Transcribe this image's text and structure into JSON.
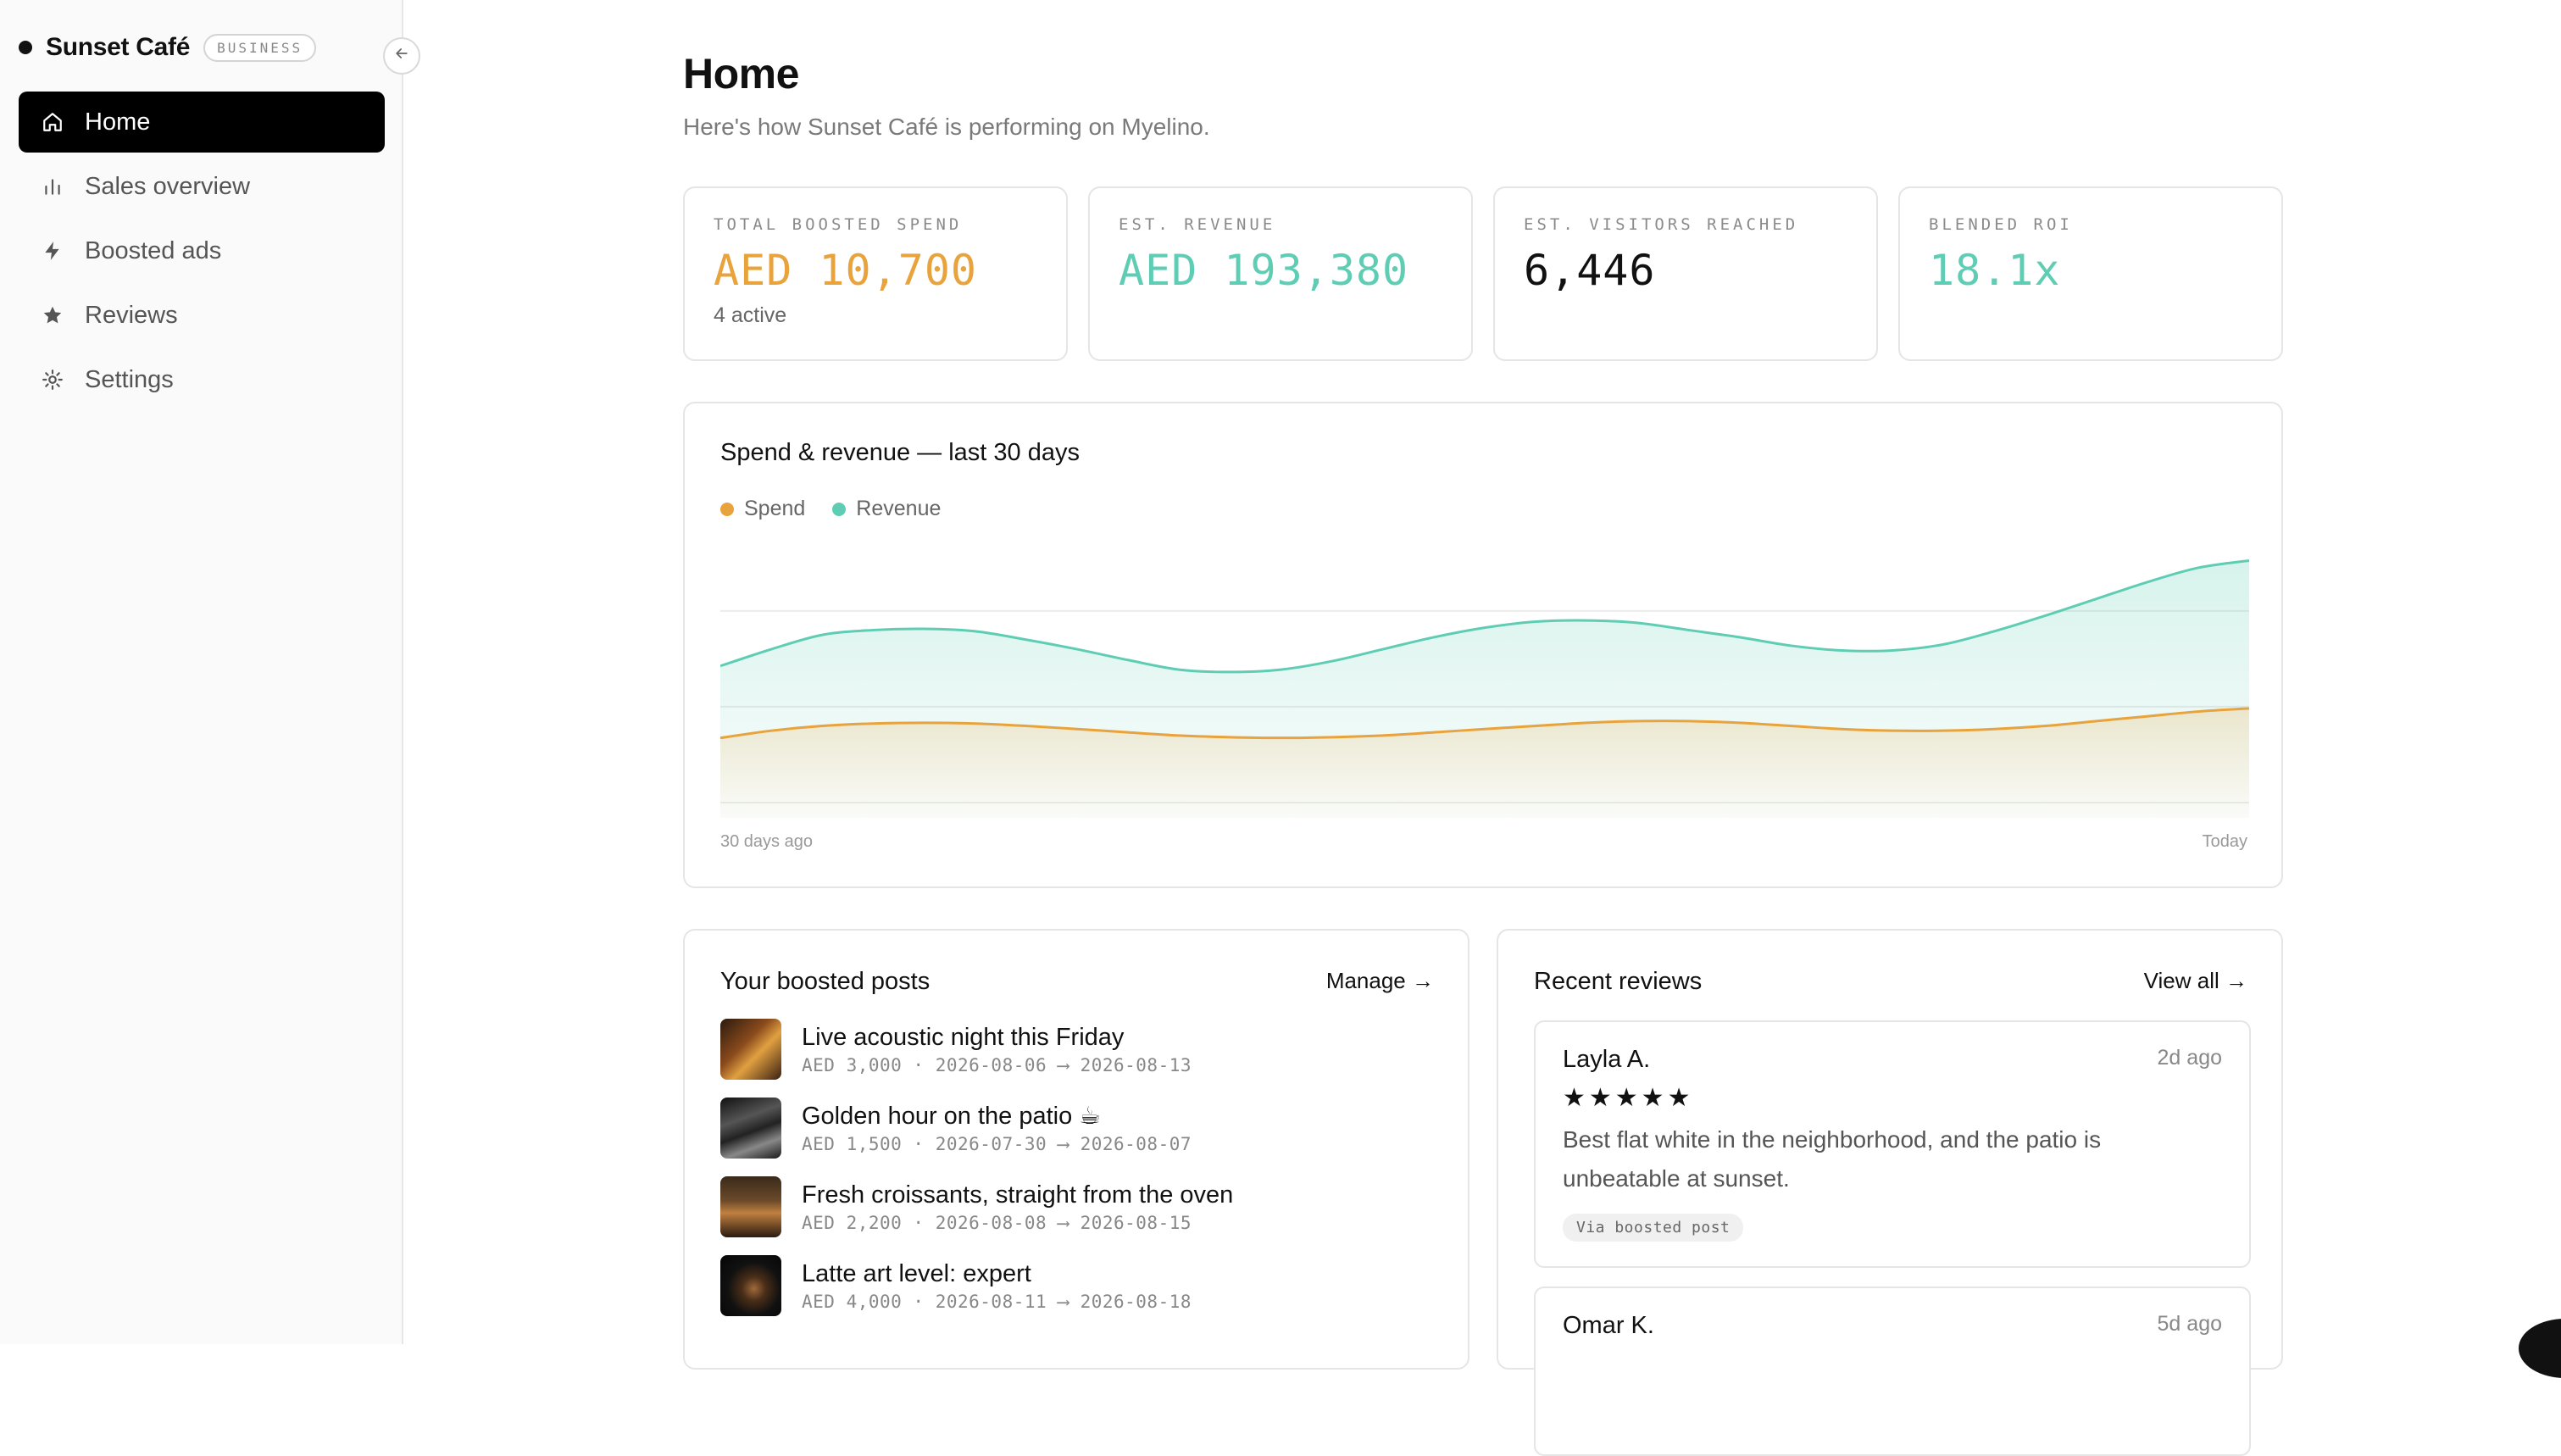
{
  "brand": {
    "name": "Sunset Café",
    "badge": "BUSINESS"
  },
  "sidebar": {
    "collapse_icon": "arrow-left-icon",
    "items": [
      {
        "label": "Home",
        "icon": "home-icon",
        "active": true
      },
      {
        "label": "Sales overview",
        "icon": "bar-chart-icon",
        "active": false
      },
      {
        "label": "Boosted ads",
        "icon": "lightning-icon",
        "active": false
      },
      {
        "label": "Reviews",
        "icon": "star-icon",
        "active": false
      },
      {
        "label": "Settings",
        "icon": "gear-icon",
        "active": false
      }
    ]
  },
  "header": {
    "title": "Home",
    "subtitle": "Here's how Sunset Café is performing on Myelino."
  },
  "stats": [
    {
      "label": "TOTAL BOOSTED SPEND",
      "value": "AED 10,700",
      "sub": "4 active",
      "color": "#E8A33D"
    },
    {
      "label": "EST. REVENUE",
      "value": "AED 193,380",
      "sub": "",
      "color": "#5FCDB4"
    },
    {
      "label": "EST. VISITORS REACHED",
      "value": "6,446",
      "sub": "",
      "color": "#111111"
    },
    {
      "label": "BLENDED ROI",
      "value": "18.1x",
      "sub": "",
      "color": "#5FCDB4"
    }
  ],
  "chart": {
    "title": "Spend & revenue — last 30 days",
    "x_start_label": "30 days ago",
    "x_end_label": "Today"
  },
  "chart_data": {
    "type": "area",
    "title": "Spend & revenue — last 30 days",
    "x": [
      0,
      1,
      2,
      3,
      4,
      5,
      6,
      7,
      8,
      9,
      10,
      11,
      12,
      13,
      14,
      15,
      16,
      17,
      18,
      19,
      20,
      21,
      22,
      23,
      24,
      25,
      26,
      27,
      28,
      29,
      30
    ],
    "xlabel": "",
    "ylabel": "",
    "grid": true,
    "legend_position": "top-left",
    "series": [
      {
        "name": "Spend",
        "color": "#E8A33D",
        "values": [
          27,
          30,
          32,
          33,
          33.3,
          33,
          32,
          30.7,
          29.3,
          28,
          27.3,
          27,
          27.3,
          28,
          29.3,
          30.7,
          32,
          33.3,
          34,
          34,
          33.3,
          32,
          30.7,
          30,
          30,
          30.7,
          32,
          34,
          36,
          38,
          39.3
        ]
      },
      {
        "name": "Revenue",
        "color": "#5FCDB4",
        "values": [
          57,
          64,
          70,
          72,
          72.5,
          71.5,
          68,
          64,
          59.5,
          55.5,
          54.5,
          55.5,
          59,
          64,
          69,
          73,
          75.5,
          76,
          75,
          72,
          69,
          65.5,
          63.5,
          63.5,
          66,
          71.5,
          78,
          85,
          92,
          98,
          101
        ]
      }
    ],
    "ylim": [
      0,
      110
    ]
  },
  "posts_card": {
    "title": "Your boosted posts",
    "link": "Manage →",
    "posts": [
      {
        "title": "Live acoustic night this Friday",
        "meta": "AED 3,000 · 2026-08-06 ⟶ 2026-08-13"
      },
      {
        "title": "Golden hour on the patio ☕",
        "meta": "AED 1,500 · 2026-07-30 ⟶ 2026-08-07"
      },
      {
        "title": "Fresh croissants, straight from the oven",
        "meta": "AED 2,200 · 2026-08-08 ⟶ 2026-08-15"
      },
      {
        "title": "Latte art level: expert",
        "meta": "AED 4,000 · 2026-08-11 ⟶ 2026-08-18"
      }
    ]
  },
  "reviews_card": {
    "title": "Recent reviews",
    "link": "View all →",
    "reviews": [
      {
        "author": "Layla A.",
        "time": "2d ago",
        "stars": "★★★★★",
        "rating": 5,
        "text": "Best flat white in the neighborhood, and the patio is unbeatable at sunset.",
        "tag": "Via boosted post"
      },
      {
        "author": "Omar K.",
        "time": "5d ago"
      }
    ]
  }
}
